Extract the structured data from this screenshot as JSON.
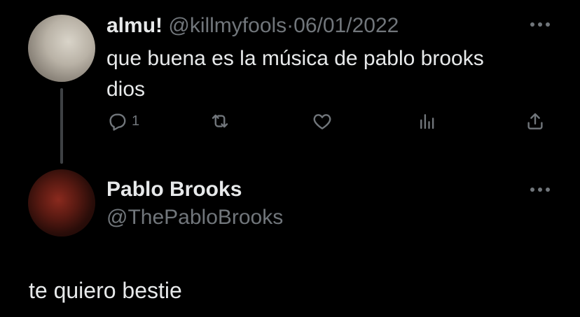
{
  "tweet": {
    "display_name": "almu!",
    "handle": "@killmyfools",
    "separator": "·",
    "date": "06/01/2022",
    "text_line1": "que buena es la música de pablo brooks",
    "text_line2": "dios",
    "more_icon": "more-horizontal-icon",
    "actions": {
      "reply_count": "1",
      "icons": [
        "reply-icon",
        "retweet-icon",
        "like-icon",
        "views-icon",
        "share-icon"
      ]
    }
  },
  "reply": {
    "display_name": "Pablo Brooks",
    "handle": "@ThePabloBrooks",
    "text": "te quiero bestie",
    "more_icon": "more-horizontal-icon"
  },
  "colors": {
    "background": "#000000",
    "primary_text": "#e7e9ea",
    "secondary_text": "#71767b",
    "thread_line": "#3e4144"
  }
}
